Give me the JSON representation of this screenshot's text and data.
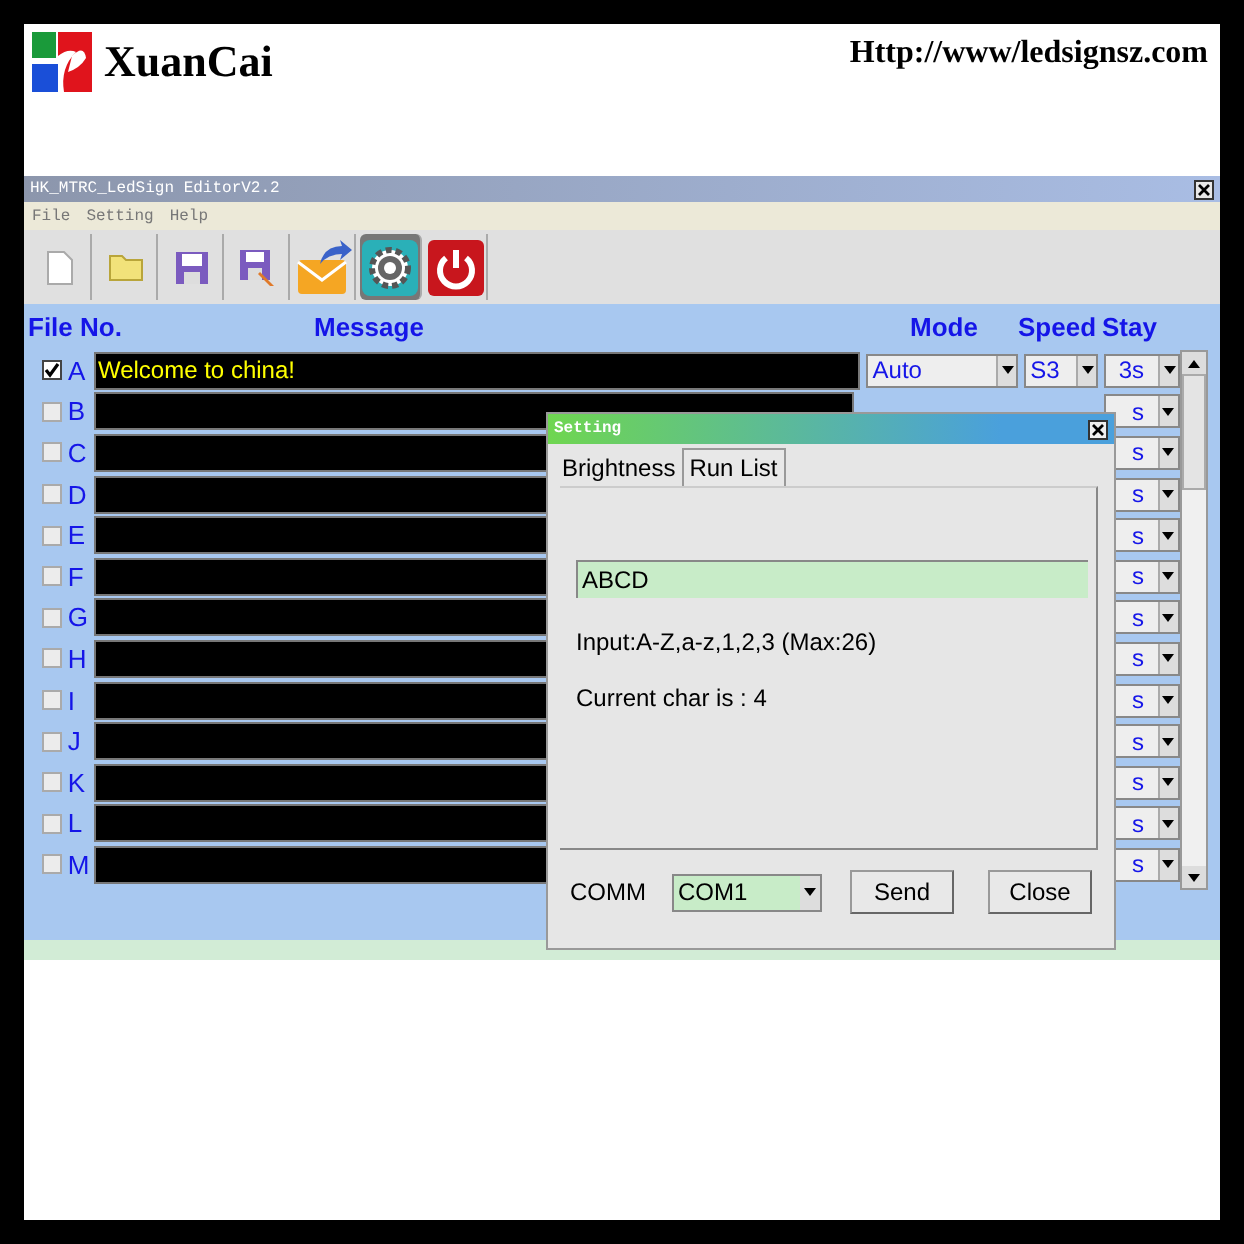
{
  "header": {
    "brand": "XuanCai",
    "url": "Http://www/ledsignsz.com"
  },
  "window": {
    "title": "HK_MTRC_LedSign EditorV2.2",
    "menu": [
      "File",
      "Setting",
      "Help"
    ]
  },
  "columns": {
    "file_no": "File No.",
    "message": "Message",
    "mode": "Mode",
    "speed": "Speed",
    "stay": "Stay"
  },
  "rows": [
    {
      "letter": "A",
      "checked": true,
      "message": "Welcome to china!",
      "mode": "Auto",
      "speed": "S3",
      "stay": "3s"
    },
    {
      "letter": "B",
      "checked": false,
      "stay": "s"
    },
    {
      "letter": "C",
      "checked": false,
      "stay": "s"
    },
    {
      "letter": "D",
      "checked": false,
      "stay": "s"
    },
    {
      "letter": "E",
      "checked": false,
      "stay": "s"
    },
    {
      "letter": "F",
      "checked": false,
      "stay": "s"
    },
    {
      "letter": "G",
      "checked": false,
      "stay": "s"
    },
    {
      "letter": "H",
      "checked": false,
      "stay": "s"
    },
    {
      "letter": "I",
      "checked": false,
      "stay": "s"
    },
    {
      "letter": "J",
      "checked": false,
      "stay": "s"
    },
    {
      "letter": "K",
      "checked": false,
      "stay": "s"
    },
    {
      "letter": "L",
      "checked": false,
      "stay": "s"
    },
    {
      "letter": "M",
      "checked": false,
      "stay": "s"
    }
  ],
  "dialog": {
    "title": "Setting",
    "tabs": [
      {
        "label": "Brightness",
        "selected": false
      },
      {
        "label": "Run List",
        "selected": true
      }
    ],
    "run_list": {
      "value": "ABCD",
      "hint": "Input:A-Z,a-z,1,2,3 (Max:26)",
      "count": "Current char is : 4"
    },
    "comm_label": "COMM",
    "comm_port": "COM1",
    "buttons": [
      "Send",
      "Close"
    ]
  }
}
